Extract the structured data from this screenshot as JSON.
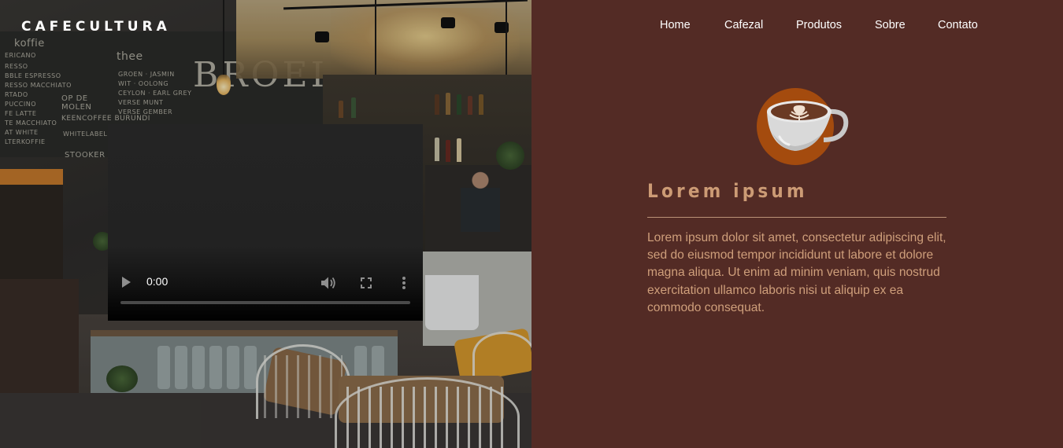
{
  "brand": {
    "name": "CAFECULTURA"
  },
  "nav": {
    "items": [
      "Home",
      "Cafezal",
      "Produtos",
      "Sobre",
      "Contato"
    ]
  },
  "hero": {
    "image": "cafe-interior-photo"
  },
  "video": {
    "time": "0:00",
    "progress": 0,
    "icons": [
      "play-icon",
      "volume-icon",
      "fullscreen-icon",
      "more-options-icon"
    ]
  },
  "section": {
    "icon": "coffee-cup-icon",
    "heading": "Lorem ipsum",
    "body": "Lorem ipsum dolor sit amet, consectetur adipiscing elit, sed do eiusmod tempor incididunt ut labore et dolore magna aliqua. Ut enim ad minim veniam, quis nostrud exercitation ullamco laboris nisi ut aliquip ex ea commodo consequat."
  },
  "colors": {
    "panel_bg": "#532b25",
    "heading": "#cc9b75",
    "body_text": "#cf9f7b",
    "rule": "#bb9177",
    "cup_accent": "#a44b0e"
  }
}
